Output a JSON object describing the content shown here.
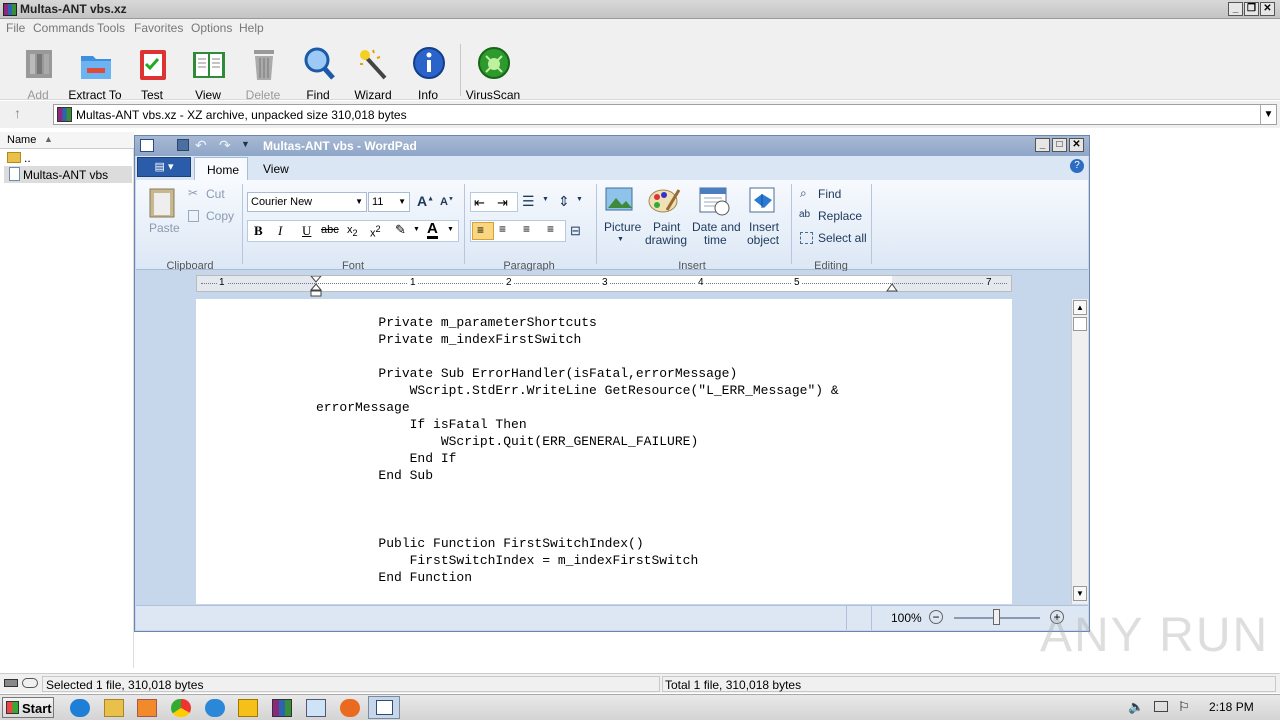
{
  "winrar": {
    "title": "Multas-ANT vbs.xz",
    "menu": [
      "File",
      "Commands",
      "Tools",
      "Favorites",
      "Options",
      "Help"
    ],
    "toolbar": [
      {
        "label": "Add",
        "icon": "add-icon",
        "disabled": true
      },
      {
        "label": "Extract To",
        "icon": "extract-to-icon",
        "disabled": false
      },
      {
        "label": "Test",
        "icon": "test-icon",
        "disabled": false
      },
      {
        "label": "View",
        "icon": "view-icon",
        "disabled": false
      },
      {
        "label": "Delete",
        "icon": "delete-icon",
        "disabled": true
      },
      {
        "label": "Find",
        "icon": "find-icon",
        "disabled": false
      },
      {
        "label": "Wizard",
        "icon": "wizard-icon",
        "disabled": false
      },
      {
        "label": "Info",
        "icon": "info-icon",
        "disabled": false
      },
      {
        "label": "VirusScan",
        "icon": "virusscan-icon",
        "disabled": false
      }
    ],
    "address": "Multas-ANT vbs.xz - XZ archive, unpacked size 310,018 bytes",
    "column_name": "Name",
    "files": [
      {
        "name": ".."
      },
      {
        "name": "Multas-ANT vbs"
      }
    ],
    "status_left": "Selected 1 file, 310,018 bytes",
    "status_right": "Total 1 file, 310,018 bytes"
  },
  "wordpad": {
    "title": "Multas-ANT vbs - WordPad",
    "tabs": [
      "Home",
      "View"
    ],
    "clipboard": {
      "paste": "Paste",
      "cut": "Cut",
      "copy": "Copy",
      "group": "Clipboard"
    },
    "font": {
      "family": "Courier New",
      "size": "11",
      "group": "Font"
    },
    "paragraph_group": "Paragraph",
    "insert": {
      "picture": "Picture",
      "paint1": "Paint",
      "paint2": "drawing",
      "date1": "Date and",
      "date2": "time",
      "obj1": "Insert",
      "obj2": "object",
      "group": "Insert"
    },
    "editing": {
      "find": "Find",
      "replace": "Replace",
      "select_all": "Select all",
      "group": "Editing"
    },
    "ruler_numbers": [
      "1",
      "1",
      "2",
      "3",
      "4",
      "5",
      "7"
    ],
    "code_lines": [
      "        Private m_parameterShortcuts",
      "        Private m_indexFirstSwitch",
      "",
      "        Private Sub ErrorHandler(isFatal,errorMessage)",
      "            WScript.StdErr.WriteLine GetResource(\"L_ERR_Message\") &",
      "errorMessage",
      "            If isFatal Then",
      "                WScript.Quit(ERR_GENERAL_FAILURE)",
      "            End If",
      "        End Sub",
      "",
      "",
      "",
      "        Public Function FirstSwitchIndex()",
      "            FirstSwitchIndex = m_indexFirstSwitch",
      "        End Function"
    ],
    "zoom": "100%"
  },
  "taskbar": {
    "start": "Start",
    "clock": "2:18 PM"
  },
  "watermark": "ANY RUN"
}
